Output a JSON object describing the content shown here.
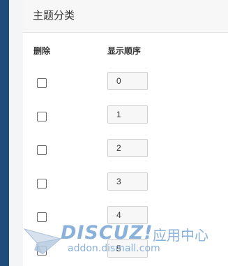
{
  "panel": {
    "title": "主题分类"
  },
  "table": {
    "headers": {
      "delete": "删除",
      "order": "显示顺序"
    },
    "rows": [
      {
        "checked": false,
        "order": "0"
      },
      {
        "checked": false,
        "order": "1"
      },
      {
        "checked": false,
        "order": "2"
      },
      {
        "checked": false,
        "order": "3"
      },
      {
        "checked": false,
        "order": "4"
      },
      {
        "checked": false,
        "order": "5"
      }
    ]
  },
  "watermark": {
    "logo": "DISCUZ!",
    "app_center": "应用中心",
    "url": "addon.dismall.com"
  },
  "colors": {
    "sidebar": "#1e4d7a",
    "header_bg": "#f7f7f7",
    "watermark": "#7ea9d6"
  }
}
